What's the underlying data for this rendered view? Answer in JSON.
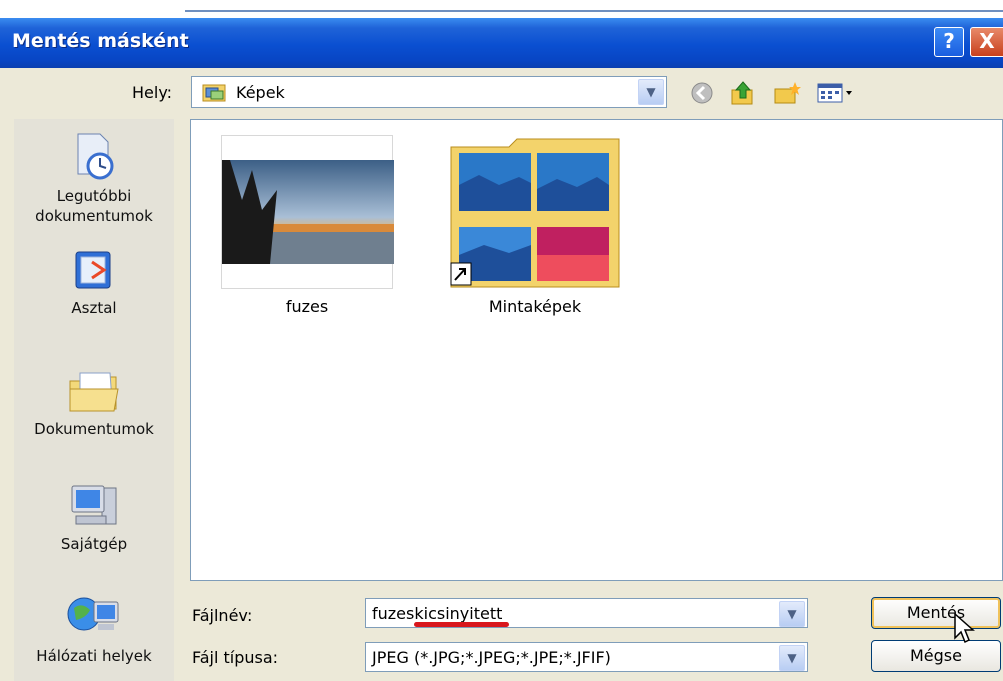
{
  "window": {
    "title": "Mentés másként"
  },
  "title_buttons": {
    "help": "?",
    "close": "X"
  },
  "location": {
    "label": "Hely:",
    "value": "Képek"
  },
  "toolbar": {
    "icons": [
      "back-icon",
      "up-folder-icon",
      "new-folder-icon",
      "views-menu-icon"
    ]
  },
  "places": [
    {
      "label": "Legutóbbi dokumentumok",
      "icon": "recent-documents-icon"
    },
    {
      "label": "Asztal",
      "icon": "desktop-icon"
    },
    {
      "label": "Dokumentumok",
      "icon": "my-documents-icon"
    },
    {
      "label": "Sajátgép",
      "icon": "my-computer-icon"
    },
    {
      "label": "Hálózati helyek",
      "icon": "network-places-icon"
    }
  ],
  "files": [
    {
      "name": "fuzes",
      "type": "image"
    },
    {
      "name": "Mintaképek",
      "type": "folder-shortcut"
    }
  ],
  "filename": {
    "label": "Fájlnév:",
    "value": "fuzeskicsinyitett"
  },
  "filetype": {
    "label": "Fájl típusa:",
    "value": "JPEG (*.JPG;*.JPEG;*.JPE;*.JFIF)"
  },
  "buttons": {
    "save": "Mentés",
    "cancel": "Mégse"
  },
  "colors": {
    "titlebar": "#0a4fd1",
    "annotation_underline": "#d8171d"
  }
}
